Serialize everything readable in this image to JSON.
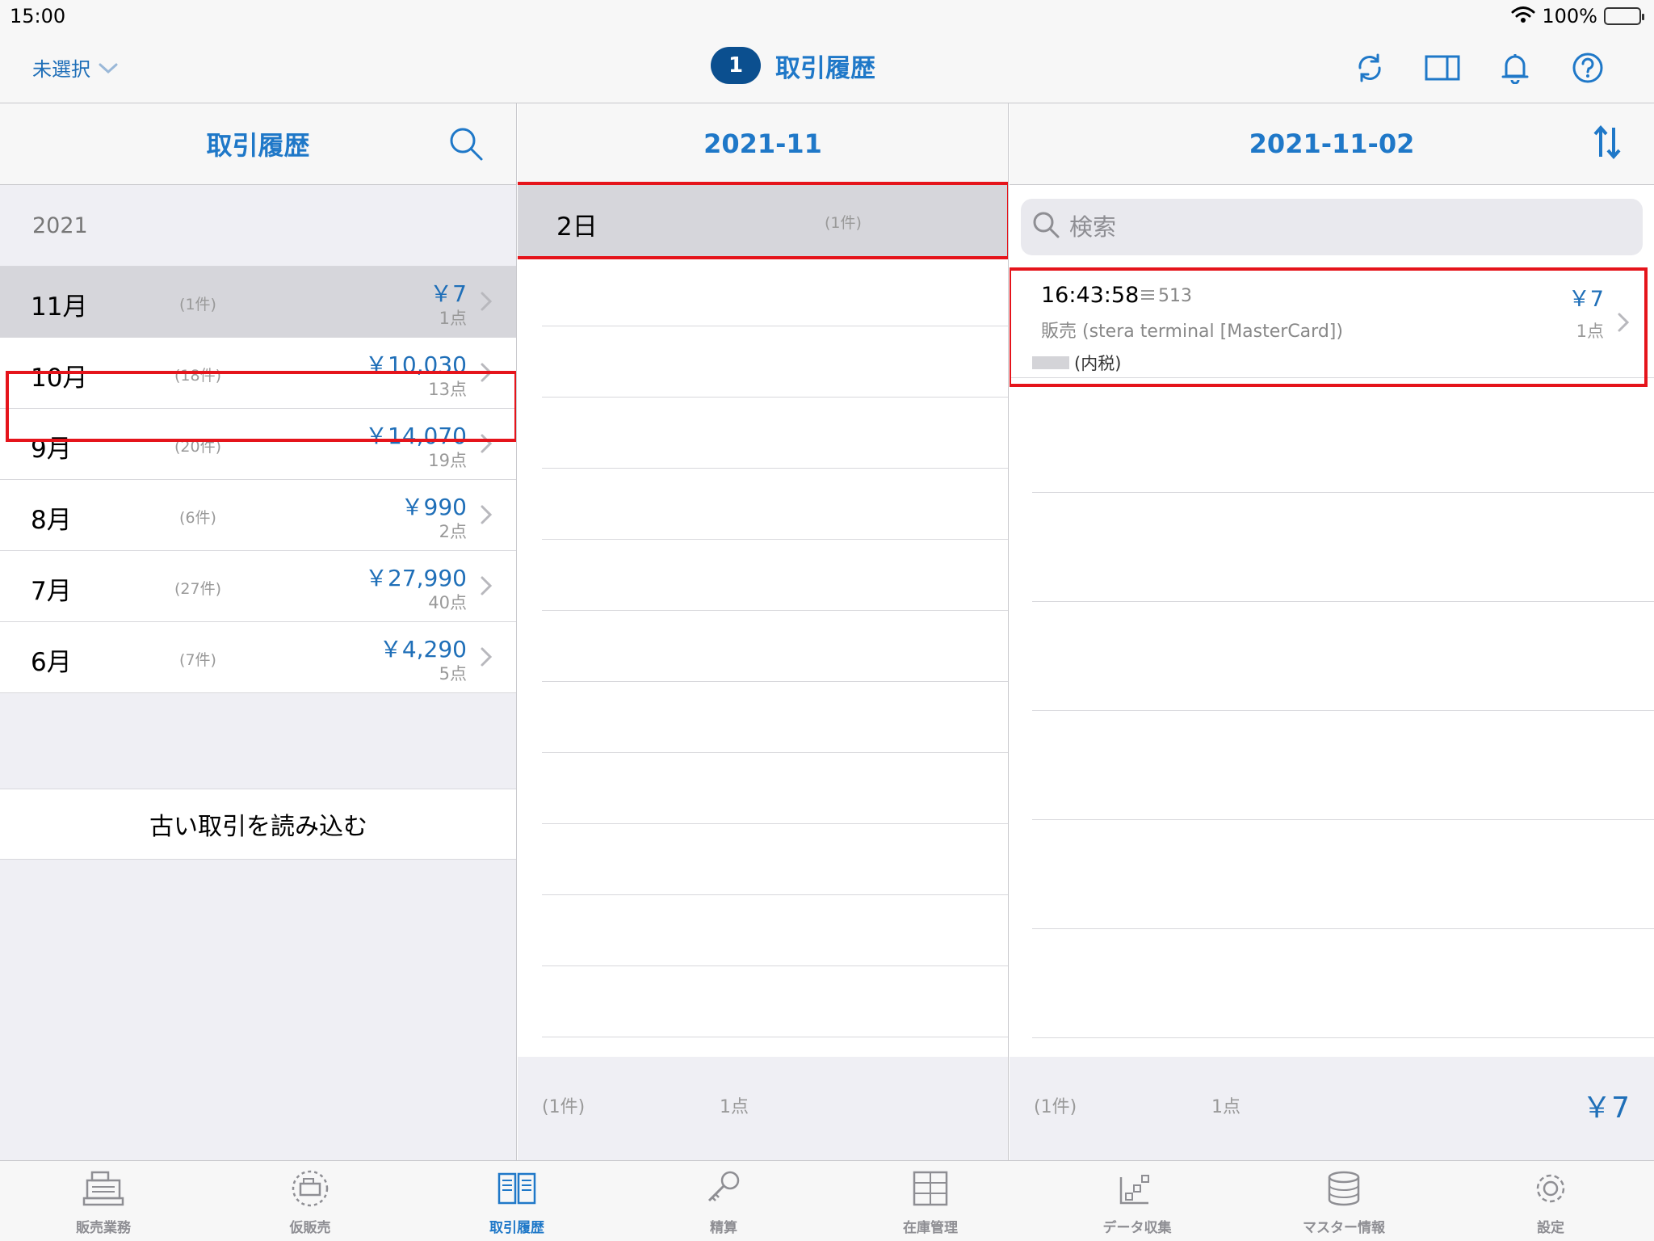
{
  "status_bar": {
    "time": "15:00",
    "battery": "100%"
  },
  "nav": {
    "store_select": "未選択",
    "badge": "1",
    "title": "取引履歴",
    "icons": [
      "refresh-icon",
      "split-view-icon",
      "bell-icon",
      "help-icon"
    ]
  },
  "panel_months": {
    "title": "取引履歴",
    "year": "2021",
    "months": [
      {
        "label": "11月",
        "count": "(1件)",
        "amount": "￥7",
        "points": "1点",
        "selected": true
      },
      {
        "label": "10月",
        "count": "(18件)",
        "amount": "￥10,030",
        "points": "13点"
      },
      {
        "label": "9月",
        "count": "(20件)",
        "amount": "￥14,070",
        "points": "19点"
      },
      {
        "label": "8月",
        "count": "(6件)",
        "amount": "￥990",
        "points": "2点"
      },
      {
        "label": "7月",
        "count": "(27件)",
        "amount": "￥27,990",
        "points": "40点"
      },
      {
        "label": "6月",
        "count": "(7件)",
        "amount": "￥4,290",
        "points": "5点"
      }
    ],
    "load_old": "古い取引を読み込む"
  },
  "panel_days": {
    "title": "2021-11",
    "days": [
      {
        "label": "2日",
        "count": "(1件)"
      }
    ],
    "footer": {
      "count": "(1件)",
      "points": "1点"
    }
  },
  "panel_transactions": {
    "title": "2021-11-02",
    "search_placeholder": "検索",
    "transactions": [
      {
        "time": "16:43:58",
        "number": "513",
        "amount": "￥7",
        "payment": "販売 (stera terminal [MasterCard])",
        "points": "1点",
        "tax": "(内税)"
      }
    ],
    "footer": {
      "count": "(1件)",
      "points": "1点",
      "total": "￥7"
    }
  },
  "tabs": [
    {
      "label": "販売業務",
      "icon": "register-icon"
    },
    {
      "label": "仮販売",
      "icon": "temp-register-icon"
    },
    {
      "label": "取引履歴",
      "icon": "history-book-icon",
      "active": true
    },
    {
      "label": "精算",
      "icon": "key-icon"
    },
    {
      "label": "在庫管理",
      "icon": "inventory-cabinet-icon"
    },
    {
      "label": "データ収集",
      "icon": "data-collection-icon"
    },
    {
      "label": "マスター情報",
      "icon": "database-icon"
    },
    {
      "label": "設定",
      "icon": "gear-icon"
    }
  ],
  "colors": {
    "accent": "#1f78c8",
    "badge": "#0b4f8f",
    "highlight": "#e5141b"
  }
}
